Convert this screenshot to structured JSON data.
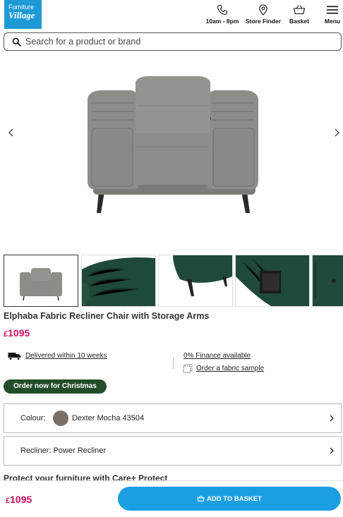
{
  "brand": {
    "line1": "Furniture",
    "line2": "Village"
  },
  "header": {
    "hours_label": "10am - 8pm",
    "store_label": "Store Finder",
    "basket_label": "Basket",
    "menu_label": "Menu"
  },
  "search": {
    "placeholder": "Search for a product or brand"
  },
  "product": {
    "title": "Elphaba Fabric Recliner Chair with Storage Arms",
    "currency": "£",
    "price": "1095"
  },
  "info": {
    "delivery": "Delivered within 10 weeks",
    "finance": "0% Finance available",
    "sample": "Order a fabric sample"
  },
  "badge": "Order now for Christmas",
  "options": {
    "colour_label": "Colour:",
    "colour_value": "Dexter Mocha 43504",
    "recliner_label": "Recliner: Power Recliner"
  },
  "protect_heading": "Protect your furniture with Care+ Protect",
  "sticky": {
    "currency": "£",
    "price": "1095",
    "add_label": "ADD TO BASKET"
  },
  "colors": {
    "brand_blue": "#1d9ad6",
    "button_blue": "#1b9fe2",
    "price_pink": "#d0105f",
    "badge_green": "#224d2a",
    "swatch": "#7a7068"
  },
  "icons": [
    "phone-icon",
    "location-pin-icon",
    "basket-icon",
    "menu-icon",
    "search-icon",
    "chevron-left-icon",
    "chevron-right-icon",
    "truck-icon",
    "fabric-sample-icon",
    "chevron-right-icon"
  ]
}
